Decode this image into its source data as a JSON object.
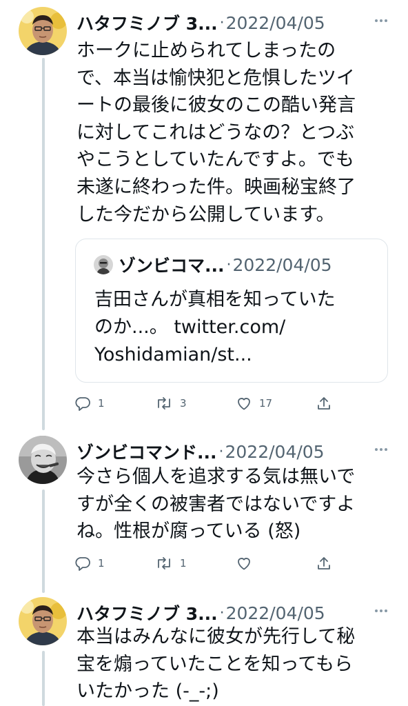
{
  "colors": {
    "text": "#0f1419",
    "muted": "#536471",
    "line": "#cfd9de"
  },
  "tweets": [
    {
      "author": "ハタフミノブ 3...",
      "date": "2022/04/05",
      "separator": "·",
      "lines": [
        "ホークに止められてしまったの",
        "で、本当は愉快犯と危惧したツイ",
        "ートの最後に彼女のこの酷い発言",
        "に対してこれはどうなの？とつぶ",
        "やこうとしていたんですよ。でも",
        "未遂に終わった件。映画秘宝終了",
        "した今だから公開しています。"
      ],
      "quote": {
        "author": "ゾンビコマ...",
        "date": "2022/04/05",
        "separator": "·",
        "lines": [
          "吉田さんが真相を知っていた",
          "のか...。 twitter.com/",
          "Yoshidamian/st..."
        ]
      },
      "actions": {
        "reply": "1",
        "retweet": "3",
        "like": "17"
      }
    },
    {
      "author": "ゾンビコマンド...",
      "date": "2022/04/05",
      "separator": "·",
      "lines": [
        "今さら個人を追求する気は無いで",
        "すが全くの被害者ではないですよ",
        "ね。性根が腐っている (怒)"
      ],
      "actions": {
        "reply": "1",
        "retweet": "1",
        "like": ""
      }
    },
    {
      "author": "ハタフミノブ 3...",
      "date": "2022/04/05",
      "separator": "·",
      "lines": [
        "本当はみんなに彼女が先行して秘",
        "宝を煽っていたことを知ってもら",
        "いたかった (-_-;)"
      ]
    }
  ]
}
